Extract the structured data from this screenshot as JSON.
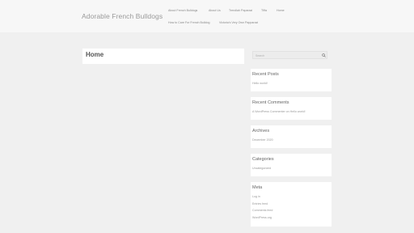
{
  "site": {
    "title": "Adorable French Bulldogs"
  },
  "nav": {
    "row1": [
      "About French Bulldogs",
      "About Us",
      "Trendlah Paparazi",
      "Tfifa",
      "Home"
    ],
    "row2": [
      "How to Care For French Bulldog",
      "Victoria's Very Own Papparazi"
    ]
  },
  "main": {
    "page_title": "Home"
  },
  "search": {
    "placeholder": "Search"
  },
  "sidebar": {
    "recent_posts": {
      "title": "Recent Posts",
      "items": [
        "Hello world!"
      ]
    },
    "recent_comments": {
      "title": "Recent Comments",
      "items": [
        "A WordPress Commenter on Hello world!"
      ]
    },
    "archives": {
      "title": "Archives",
      "items": [
        "December 2020"
      ]
    },
    "categories": {
      "title": "Categories",
      "items": [
        "Uncategorized"
      ]
    },
    "meta": {
      "title": "Meta",
      "items": [
        "Log in",
        "Entries feed",
        "Comments feed",
        "WordPress.org"
      ]
    }
  }
}
